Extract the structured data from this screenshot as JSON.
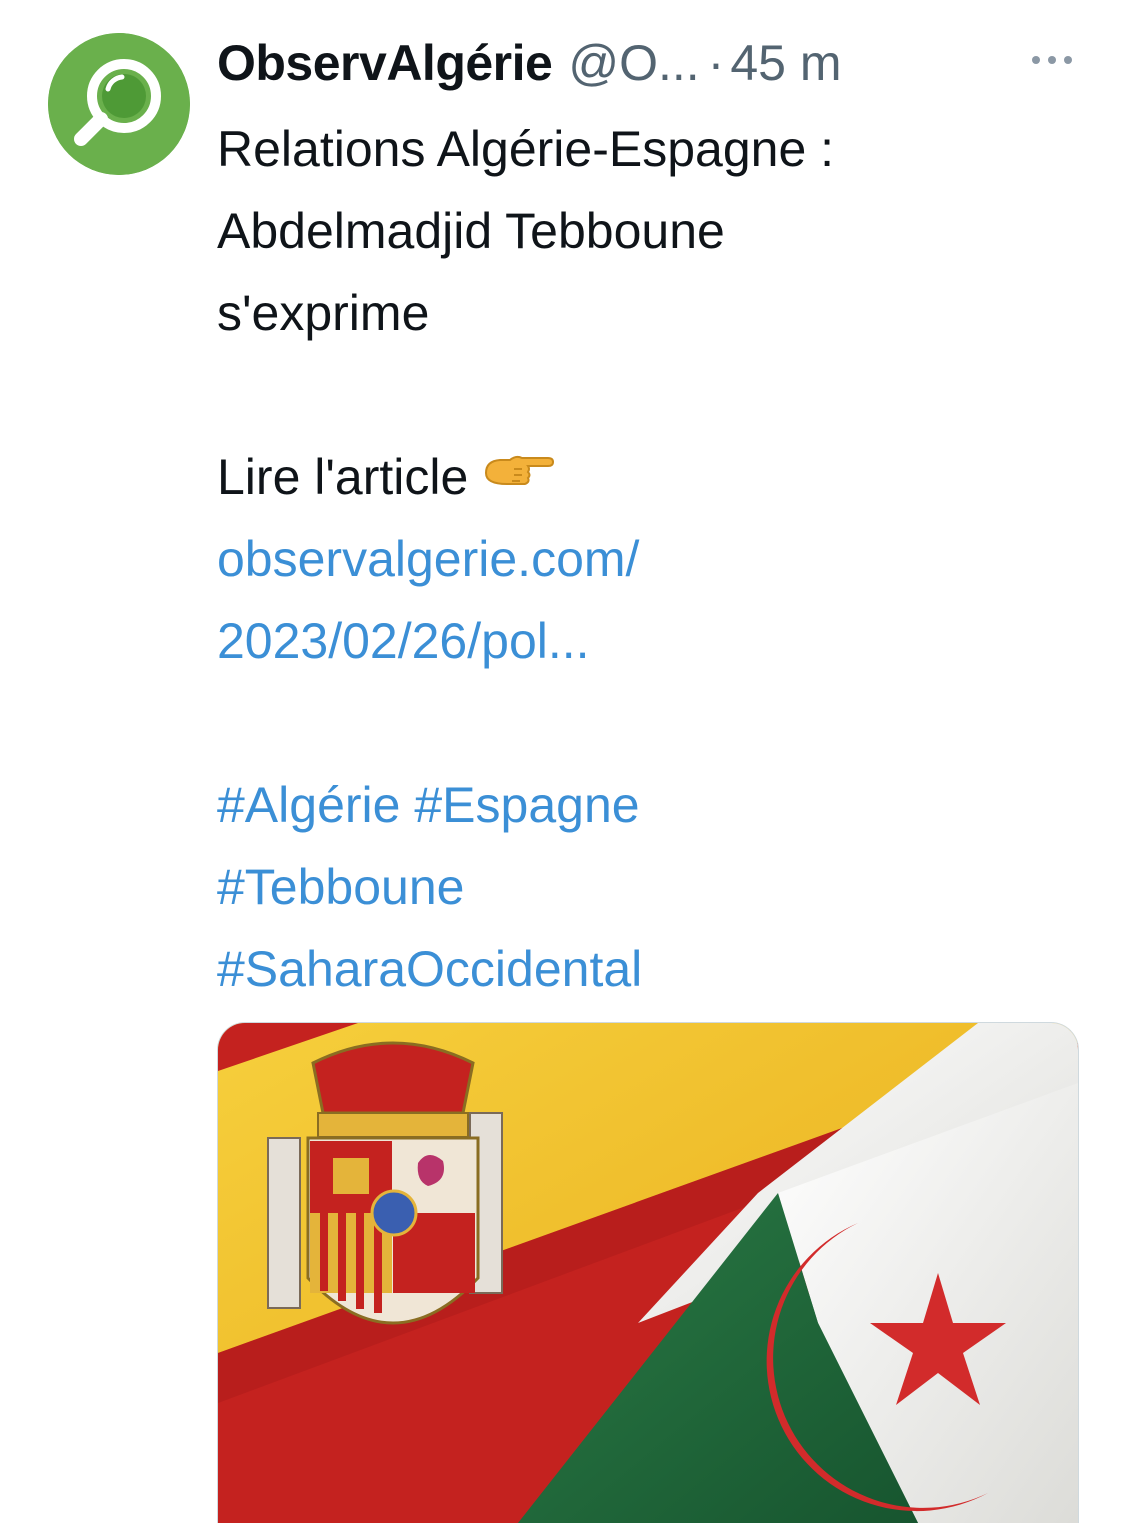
{
  "tweet": {
    "author_name": "ObservAlgérie",
    "author_handle": "@O...",
    "separator": "·",
    "timestamp": "45 m",
    "text_lines": [
      "Relations Algérie-Espagne :",
      "Abdelmadjid Tebboune",
      "s'exprime"
    ],
    "read_label": "Lire l'article",
    "link_lines": [
      "observalgerie.com/",
      "2023/02/26/pol..."
    ],
    "hashtags": {
      "algerie": "#Algérie",
      "espagne": "#Espagne",
      "tebboune": "#Tebboune",
      "sahara": "#SaharaOccidental"
    }
  },
  "icons": {
    "avatar": "magnifier-logo-icon",
    "more": "more-horizontal-icon",
    "pointing": "backhand-index-pointing-right-icon"
  },
  "colors": {
    "link": "#3b8fd6",
    "avatar_green": "#6ab04c",
    "secondary_text": "#536471",
    "spain_red": "#c4221f",
    "spain_yellow": "#f2c01e",
    "algeria_green": "#1e6b3a",
    "algeria_white": "#f2f2ef",
    "algeria_red": "#d22b2b"
  }
}
